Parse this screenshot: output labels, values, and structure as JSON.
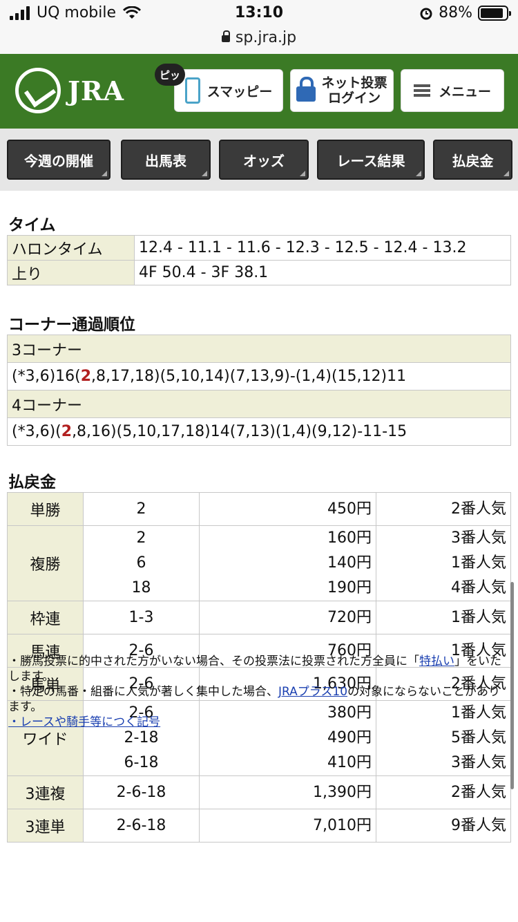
{
  "status": {
    "carrier": "UQ mobile",
    "time": "13:10",
    "battery": "88%",
    "battery_level": 0.88,
    "url": "sp.jra.jp"
  },
  "header": {
    "logo": "JRA",
    "pi_badge": "ピッ",
    "sumappy": "スマッピー",
    "login_line1": "ネット投票",
    "login_line2": "ログイン",
    "menu": "メニュー"
  },
  "nav": [
    "今週の開催",
    "出馬表",
    "オッズ",
    "レース結果",
    "払戻金"
  ],
  "time_section": {
    "title": "タイム",
    "rows": [
      {
        "label": "ハロンタイム",
        "value": "12.4 - 11.1 - 11.6 - 12.3 - 12.5 - 12.4 - 13.2"
      },
      {
        "label": "上り",
        "value": "4F 50.4 - 3F 38.1"
      }
    ]
  },
  "corner_section": {
    "title": "コーナー通過順位",
    "c3_label": "3コーナー",
    "c3_pre": "(*3,6)16(",
    "c3_hl": "2",
    "c3_post": ",8,17,18)(5,10,14)(7,13,9)-(1,4)(15,12)11",
    "c4_label": "4コーナー",
    "c4_pre": "(*3,6)(",
    "c4_hl": "2",
    "c4_post": ",8,16)(5,10,17,18)14(7,13)(1,4)(9,12)-11-15"
  },
  "payout_section": {
    "title": "払戻金",
    "rows": [
      {
        "type": "単勝",
        "entries": [
          {
            "num": "2",
            "amount": "450円",
            "pop": "2番人気"
          }
        ]
      },
      {
        "type": "複勝",
        "entries": [
          {
            "num": "2",
            "amount": "160円",
            "pop": "3番人気"
          },
          {
            "num": "6",
            "amount": "140円",
            "pop": "1番人気"
          },
          {
            "num": "18",
            "amount": "190円",
            "pop": "4番人気"
          }
        ]
      },
      {
        "type": "枠連",
        "entries": [
          {
            "num": "1-3",
            "amount": "720円",
            "pop": "1番人気"
          }
        ]
      },
      {
        "type": "馬連",
        "entries": [
          {
            "num": "2-6",
            "amount": "760円",
            "pop": "1番人気"
          }
        ]
      },
      {
        "type": "馬単",
        "entries": [
          {
            "num": "2-6",
            "amount": "1,630円",
            "pop": "2番人気"
          }
        ]
      },
      {
        "type": "ワイド",
        "entries": [
          {
            "num": "2-6",
            "amount": "380円",
            "pop": "1番人気"
          },
          {
            "num": "2-18",
            "amount": "490円",
            "pop": "5番人気"
          },
          {
            "num": "6-18",
            "amount": "410円",
            "pop": "3番人気"
          }
        ]
      },
      {
        "type": "3連複",
        "entries": [
          {
            "num": "2-6-18",
            "amount": "1,390円",
            "pop": "2番人気"
          }
        ]
      },
      {
        "type": "3連単",
        "entries": [
          {
            "num": "2-6-18",
            "amount": "7,010円",
            "pop": "9番人気"
          }
        ]
      }
    ]
  },
  "notes": {
    "n1_pre": "・勝馬投票に的中された方がいない場合、その投票法に投票された方全員に「",
    "n1_link": "特払い",
    "n1_post": "」をいたします。",
    "n2_pre": "・特定の馬番・組番に人気が著しく集中した場合、",
    "n2_link": "JRAプラス10",
    "n2_post": "の対象にならないことがあります。",
    "n3_link": "・レースや騎手等につく記号"
  }
}
